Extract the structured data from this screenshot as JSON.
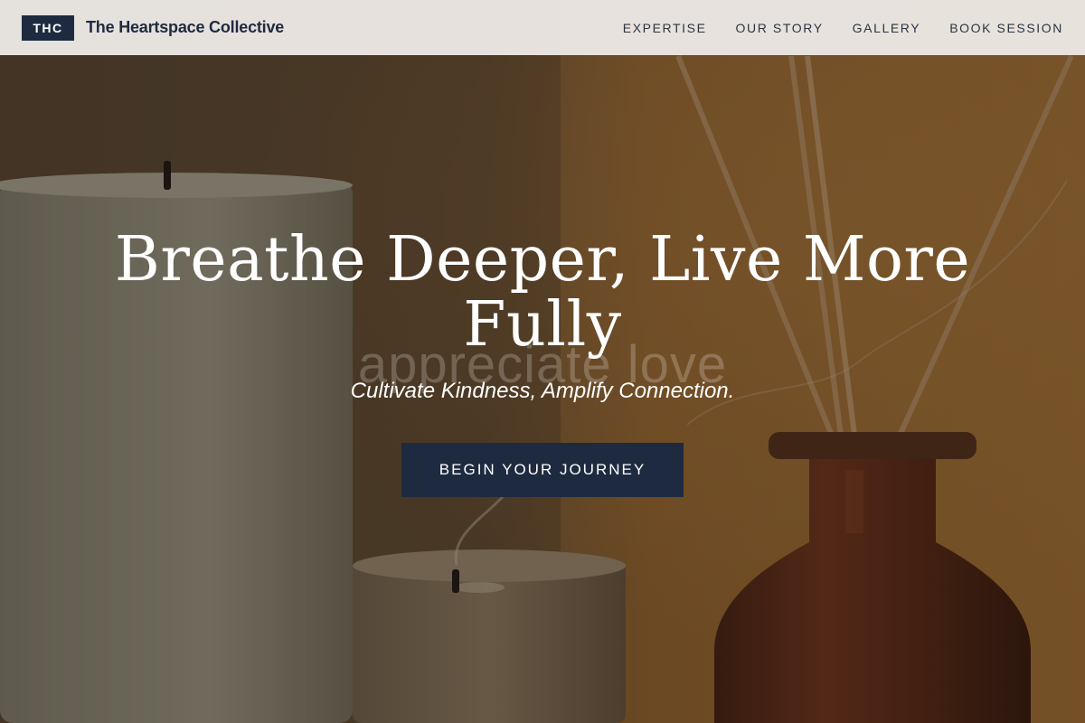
{
  "nav": {
    "brand_badge": "THC",
    "brand_name": "The Heartspace Collective",
    "links": [
      "EXPERTISE",
      "OUR STORY",
      "GALLERY",
      "BOOK SESSION"
    ]
  },
  "hero": {
    "heading_line1": "Breathe Deeper, Live More",
    "heading_line2": "Fully",
    "watermark": "appreciate love",
    "subheading": "Cultivate Kindness, Amplify Connection.",
    "cta_label": "BEGIN YOUR JOURNEY",
    "background_image": "candles-and-reed-diffuser-photo"
  },
  "colors": {
    "brand_navy": "#1e2a40",
    "nav_background": "#ece8e5",
    "text_white": "#ffffff"
  }
}
